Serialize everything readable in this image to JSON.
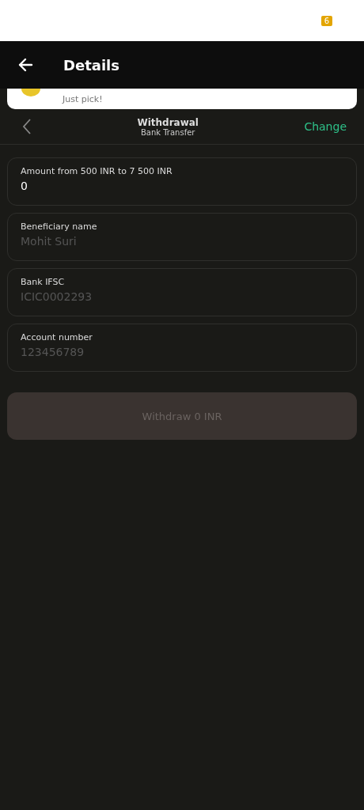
{
  "status_bar": {
    "badge": "6"
  },
  "header": {
    "title": "Details"
  },
  "toast": {
    "text": "Just pick!"
  },
  "method": {
    "title": "Withdrawal",
    "subtitle": "Bank Transfer",
    "action": "Change"
  },
  "fields": [
    {
      "label": "Amount from 500 INR to 7 500 INR",
      "value": "0"
    },
    {
      "label": "Beneficiary name",
      "placeholder": "Mohit Suri"
    },
    {
      "label": "Bank IFSC",
      "placeholder": "ICIC0002293"
    },
    {
      "label": "Account number",
      "placeholder": "123456789"
    }
  ],
  "submit": {
    "label": "Withdraw 0 INR",
    "disabled": true
  }
}
